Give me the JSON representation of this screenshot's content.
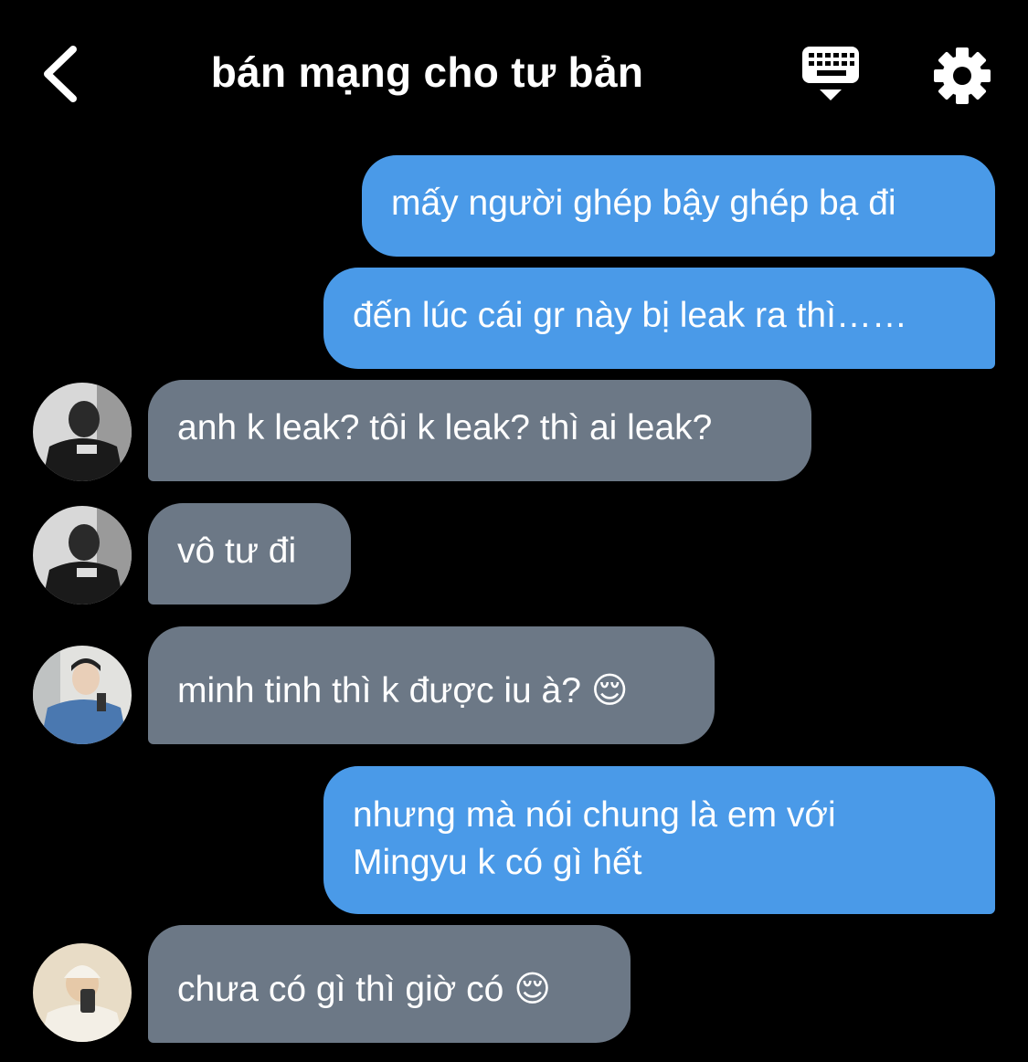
{
  "header": {
    "title": "bán mạng cho tư bản",
    "back_icon": "chevron-left-icon",
    "keyboard_icon": "keyboard-hide-icon",
    "settings_icon": "gear-icon"
  },
  "colors": {
    "background": "#000000",
    "outgoing_bubble": "#4a9ae8",
    "incoming_bubble": "#6c7886",
    "text": "#ffffff"
  },
  "messages": [
    {
      "direction": "outgoing",
      "text": "mấy người ghép bậy ghép bạ đi"
    },
    {
      "direction": "outgoing",
      "text": "đến lúc cái gr này bị leak ra thì……"
    },
    {
      "direction": "incoming",
      "avatar": "avatar-dark-jacket",
      "text": "anh k leak? tôi k leak? thì ai leak?"
    },
    {
      "direction": "incoming",
      "avatar": "avatar-dark-jacket",
      "text": "vô tư đi"
    },
    {
      "direction": "incoming",
      "avatar": "avatar-denim-jacket",
      "text": "minh tinh thì k được iu à? 😌"
    },
    {
      "direction": "outgoing",
      "text_line1": "nhưng mà nói chung là em với",
      "text_line2": "Mingyu k có gì hết"
    },
    {
      "direction": "incoming",
      "avatar": "avatar-white-beanie",
      "text": "chưa có gì thì giờ có 😌"
    }
  ]
}
